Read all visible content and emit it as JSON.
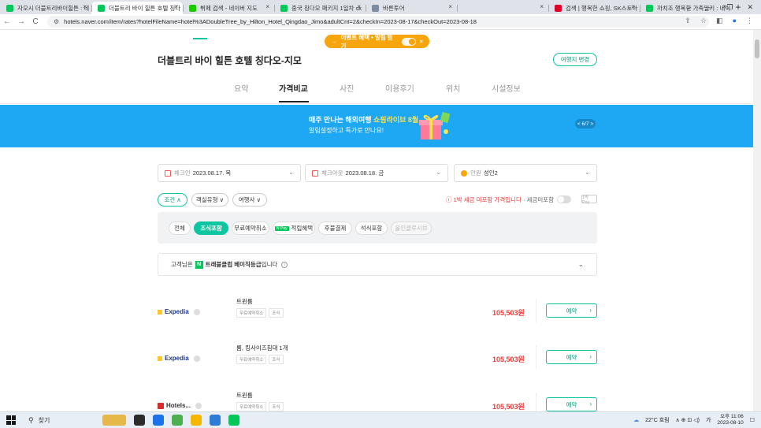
{
  "browser": {
    "tabs": [
      {
        "title": "자오시 더블트리바이힐튼 : 네",
        "color": "#03c75a",
        "active": false
      },
      {
        "title": "더블트리 바이 힐튼 호텔 칭다",
        "color": "#03c75a",
        "active": true
      },
      {
        "title": "뷔페 검색 - 네이버 지도",
        "color": "#1ec800",
        "active": false
      },
      {
        "title": "중국 칭다오 패키지 1일차 sk",
        "color": "#03c75a",
        "active": false
      },
      {
        "title": "바른투어",
        "color": "#7b8ca3",
        "active": false
      },
      {
        "title": "",
        "color": "#dfe3e9",
        "active": false
      },
      {
        "title": "검색 | 행복한 쇼핑, SK스토아",
        "color": "#e0002a",
        "active": false
      },
      {
        "title": "까치조 행복한 가족일기 : 네이",
        "color": "#03c75a",
        "active": false
      }
    ],
    "tab_close": "×",
    "new_tab": "+",
    "url": "hotels.naver.com/item/rates?hotelFileName=hotel%3ADoubleTree_by_Hilton_Hotel_Qingdao_Jimo&adultCnt=2&checkIn=2023-08-17&checkOut=2023-08-18",
    "nav": {
      "back": "←",
      "forward": "→",
      "reload": "C"
    },
    "window_controls": {
      "dropdown": "⌄",
      "min": "—",
      "max": "❐",
      "close": "✕"
    },
    "toolbar_icons": {
      "share": "⇪",
      "star": "☆",
      "sidepanel": "◧",
      "profile": "●",
      "menu": "⋮"
    }
  },
  "event_pill": {
    "arrow": "→",
    "text": "이벤트 혜택 • 알림 받기",
    "close": "×"
  },
  "header": {
    "hotel_name": "더블트리 바이 힐튼 호텔 칭다오-지모",
    "change_button": "여행지 변경"
  },
  "tabs": [
    {
      "label": "요약",
      "active": false
    },
    {
      "label": "가격비교",
      "active": true
    },
    {
      "label": "사진",
      "active": false
    },
    {
      "label": "이용후기",
      "active": false
    },
    {
      "label": "위치",
      "active": false
    },
    {
      "label": "시설정보",
      "active": false
    }
  ],
  "banner": {
    "line1_prefix": "매주 만나는 해외여행 ",
    "line1_highlight": "쇼핑라이브 8월",
    "line2": "알림설정하고 특가로 만나요!",
    "pager": "< 6/7 >",
    "background": "#1ea7f2"
  },
  "search": {
    "checkin_label": "체크인",
    "checkin_value": "2023.08.17. 목",
    "checkout_label": "체크아웃",
    "checkout_value": "2023.08.18. 금",
    "guests_label": "인원",
    "guests_value": "성인2",
    "chevron": "⌄"
  },
  "chips": {
    "condition": "조건 ∧",
    "room_type": "객실유형 ∨",
    "agency": "여행사 ∨"
  },
  "tax": {
    "icon": "ⓘ",
    "note_red": "1박 세금 미포함 가격입니다",
    "note_gray": " · 세금미포함",
    "badge": "1박 Pay"
  },
  "filters": [
    {
      "label": "전체",
      "state": "normal"
    },
    {
      "label": "조식포함",
      "state": "on"
    },
    {
      "label": "무료예약취소",
      "state": "normal"
    },
    {
      "label": "적립혜택",
      "state": "normal",
      "npay": "N Pay"
    },
    {
      "label": "후불결제",
      "state": "normal"
    },
    {
      "label": "석식포함",
      "state": "normal"
    },
    {
      "label": "올인클루시브",
      "state": "off"
    }
  ],
  "membership": {
    "prefix": "고객님은",
    "n_logo": "N",
    "grade": "트래블클럽 베이직등급",
    "suffix": " 입니다",
    "info": "i",
    "chevron": "⌄"
  },
  "offers": [
    {
      "vendor": "Expedia",
      "logo_color": "#ffc72c",
      "room": "트윈룸",
      "tags": [
        "무료예약취소",
        "조식"
      ],
      "price": "105,503원",
      "reserve": "예약",
      "arrow": "›"
    },
    {
      "vendor": "Expedia",
      "logo_color": "#ffc72c",
      "room": "룸, 킹사이즈침대 1개",
      "tags": [
        "무료예약취소",
        "조식"
      ],
      "price": "105,503원",
      "reserve": "예약",
      "arrow": "›"
    },
    {
      "vendor": "Hotels...",
      "logo_color": "#d32f2f",
      "room": "트윈룸",
      "tags": [
        "무료예약취소",
        "조식"
      ],
      "price": "105,503원",
      "reserve": "예약",
      "arrow": "›"
    }
  ],
  "taskbar": {
    "search_icon": "⚲",
    "search_placeholder": "찾기",
    "weather": "22°C 흐림",
    "tray_icons": "∧ ⊕ ⊡ ◁)",
    "ime": "가",
    "time_prefix": "오후 11:06",
    "date": "2023-08-10",
    "notification": "☐",
    "apps": [
      "#e6b84a",
      "#2b2b2b",
      "#1a73e8",
      "#4caf50",
      "#f5b700",
      "#2e7bd6",
      "#03c75a"
    ]
  }
}
